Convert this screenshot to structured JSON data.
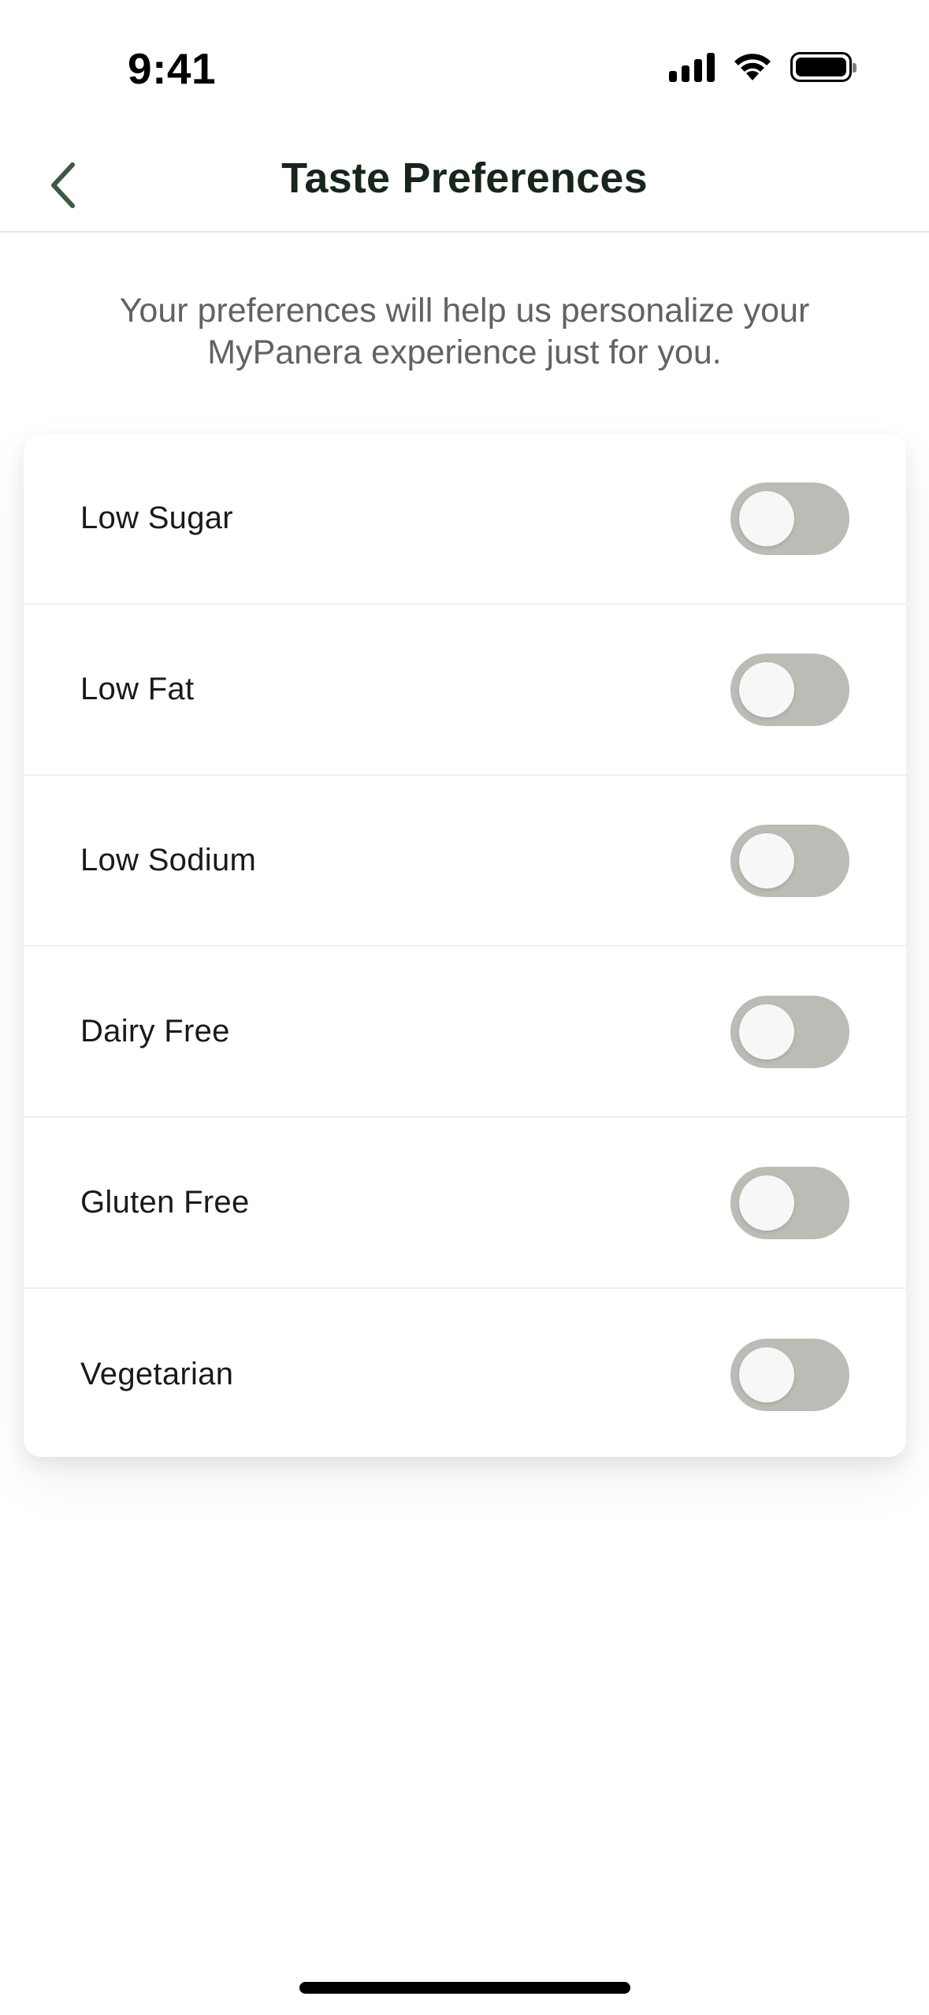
{
  "status_bar": {
    "time": "9:41"
  },
  "nav": {
    "title": "Taste Preferences",
    "back_icon": "chevron-left-icon"
  },
  "intro": {
    "text": "Your preferences will help us personalize your MyPanera experience just for you."
  },
  "preferences": [
    {
      "label": "Low Sugar",
      "enabled": false
    },
    {
      "label": "Low Fat",
      "enabled": false
    },
    {
      "label": "Low Sodium",
      "enabled": false
    },
    {
      "label": "Dairy Free",
      "enabled": false
    },
    {
      "label": "Gluten Free",
      "enabled": false
    },
    {
      "label": "Vegetarian",
      "enabled": false
    }
  ],
  "colors": {
    "title": "#17261b",
    "back_arrow": "#3d5a43",
    "intro_text": "#626262",
    "toggle_off_track": "#bdbbb5",
    "toggle_knob": "#f7f7f7"
  }
}
